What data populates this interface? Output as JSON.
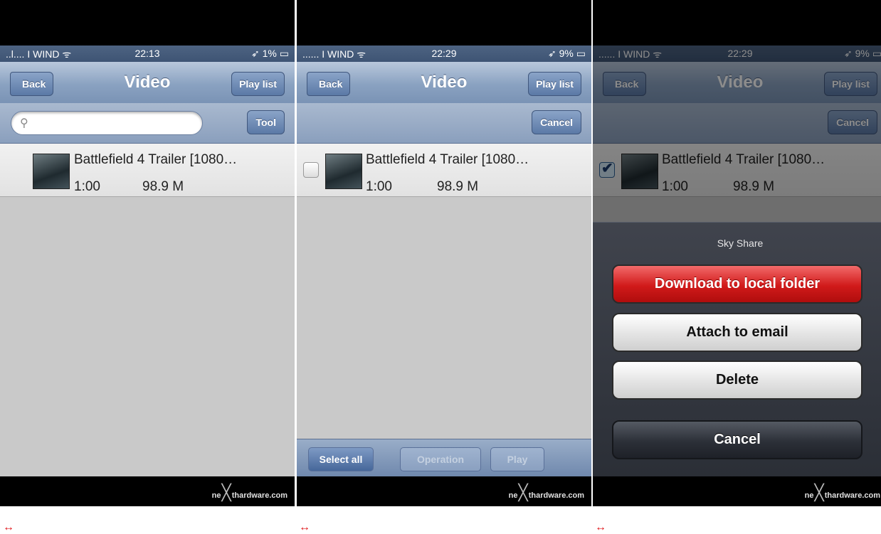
{
  "panels": [
    {
      "status": {
        "carrier": "..l.... I WIND ᯤ",
        "time": "22:13",
        "battery": "➶ 1% ▭"
      },
      "nav": {
        "back": "Back",
        "title": "Video",
        "right": "Play list"
      },
      "toolbar": {
        "search_placeholder": "",
        "button": "Tool"
      },
      "video": {
        "name": "Battlefield 4 Trailer [1080…",
        "duration": "1:00",
        "size": "98.9 M"
      }
    },
    {
      "status": {
        "carrier": "...... I WIND ᯤ",
        "time": "22:29",
        "battery": "➶ 9% ▭"
      },
      "nav": {
        "back": "Back",
        "title": "Video",
        "right": "Play list"
      },
      "toolbar": {
        "button": "Cancel"
      },
      "video": {
        "name": "Battlefield 4 Trailer [1080…",
        "duration": "1:00",
        "size": "98.9 M",
        "checked": false
      },
      "bottom": {
        "select_all": "Select all",
        "operation": "Operation",
        "play": "Play"
      }
    },
    {
      "status": {
        "carrier": "...... I WIND ᯤ",
        "time": "22:29",
        "battery": "➶ 9% ▭"
      },
      "nav": {
        "back": "Back",
        "title": "Video",
        "right": "Play list"
      },
      "toolbar": {
        "button": "Cancel"
      },
      "video": {
        "name": "Battlefield 4 Trailer [1080…",
        "duration": "1:00",
        "size": "98.9 M",
        "checked": true
      },
      "sheet": {
        "title": "Sky Share",
        "download": "Download to local folder",
        "attach": "Attach to email",
        "delete": "Delete",
        "cancel": "Cancel"
      }
    }
  ],
  "watermark": {
    "left": "ne",
    "right": "thardware.com"
  },
  "swap_glyph": "↔",
  "colors": {
    "nav_blue": "#7a93b5",
    "destructive_red": "#d11a1a",
    "content_gray": "#c9c9c9"
  }
}
